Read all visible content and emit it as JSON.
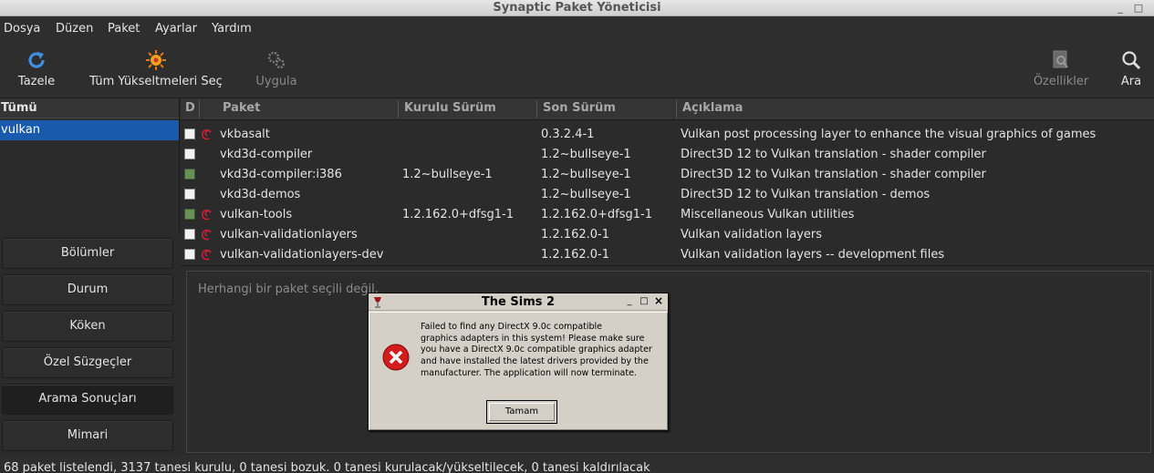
{
  "window": {
    "title": "Synaptic Paket Yöneticisi",
    "btn_min": "_",
    "btn_max": "□"
  },
  "menu": [
    "Dosya",
    "Düzen",
    "Paket",
    "Ayarlar",
    "Yardım"
  ],
  "toolbar": {
    "refresh": "Tazele",
    "mark_all": "Tüm Yükseltmeleri Seç",
    "apply": "Uygula",
    "properties": "Özellikler",
    "search": "Ara"
  },
  "categories": {
    "header": "Tümü",
    "selected": "vulkan"
  },
  "sidebar_buttons": [
    "Bölümler",
    "Durum",
    "Köken",
    "Özel Süzgeçler",
    "Arama Sonuçları",
    "Mimari"
  ],
  "list": {
    "headers": [
      "D",
      "Paket",
      "Kurulu Sürüm",
      "Son Sürüm",
      "Açıklama"
    ],
    "rows": [
      {
        "name": "vkbasalt",
        "installed": "",
        "latest": "0.3.2.4-1",
        "desc": "Vulkan post processing layer to enhance the visual graphics of games",
        "state": "none",
        "debian": true
      },
      {
        "name": "vkd3d-compiler",
        "installed": "",
        "latest": "1.2~bullseye-1",
        "desc": "Direct3D 12 to Vulkan translation - shader compiler",
        "state": "none",
        "debian": false
      },
      {
        "name": "vkd3d-compiler:i386",
        "installed": "1.2~bullseye-1",
        "latest": "1.2~bullseye-1",
        "desc": "Direct3D 12 to Vulkan translation - shader compiler",
        "state": "installed",
        "debian": false
      },
      {
        "name": "vkd3d-demos",
        "installed": "",
        "latest": "1.2~bullseye-1",
        "desc": "Direct3D 12 to Vulkan translation - demos",
        "state": "none",
        "debian": false
      },
      {
        "name": "vulkan-tools",
        "installed": "1.2.162.0+dfsg1-1",
        "latest": "1.2.162.0+dfsg1-1",
        "desc": "Miscellaneous Vulkan utilities",
        "state": "installed",
        "debian": true
      },
      {
        "name": "vulkan-validationlayers",
        "installed": "",
        "latest": "1.2.162.0-1",
        "desc": "Vulkan validation layers",
        "state": "none",
        "debian": true
      },
      {
        "name": "vulkan-validationlayers-dev",
        "installed": "",
        "latest": "1.2.162.0-1",
        "desc": "Vulkan validation layers -- development files",
        "state": "none",
        "debian": true
      }
    ]
  },
  "detail": {
    "message": "Herhangi bir paket seçili değil."
  },
  "status": "68 paket listelendi, 3137 tanesi kurulu, 0 tanesi bozuk. 0 tanesi kurulacak/yükseltilecek, 0 tanesi kaldırılacak",
  "dialog": {
    "title": "The Sims 2",
    "message_lines": [
      "Failed to find any DirectX 9.0c compatible",
      "graphics adapters in this system! Please make sure",
      "you have a DirectX 9.0c compatible graphics adapter",
      "and have installed the latest drivers provided by the",
      "manufacturer. The application will now terminate."
    ],
    "ok_label": "Tamam",
    "btn_min": "_",
    "btn_max": "□",
    "btn_close": "×"
  },
  "colors": {
    "selection": "#1a5aad",
    "installed": "#6a8f58",
    "debian": "#c71f3a",
    "error": "#d51c1c"
  }
}
